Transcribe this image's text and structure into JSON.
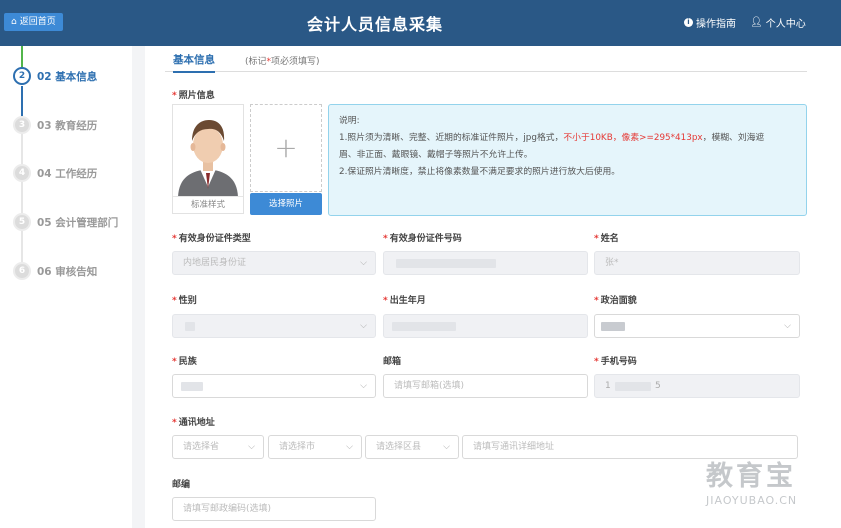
{
  "header": {
    "back_label": "返回首页",
    "title": "会计人员信息采集",
    "guide_label": "操作指南",
    "user_label": "个人中心"
  },
  "steps": [
    {
      "num": "2",
      "label": "02 基本信息",
      "active": true
    },
    {
      "num": "3",
      "label": "03 教育经历",
      "active": false
    },
    {
      "num": "4",
      "label": "04 工作经历",
      "active": false
    },
    {
      "num": "5",
      "label": "05 会计管理部门",
      "active": false
    },
    {
      "num": "6",
      "label": "06 审核告知",
      "active": false
    }
  ],
  "tabs": {
    "active_label": "基本信息",
    "note_prefix": "(标记",
    "note_star": "*",
    "note_suffix": "项必须填写)"
  },
  "photo": {
    "label": "照片信息",
    "sample_caption": "标准样式",
    "upload_plus": "+",
    "choose_button": "选择照片"
  },
  "notice": {
    "title": "说明:",
    "line1_a": "1.照片须为清晰、完整、近期的标准证件照片，jpg格式，",
    "line1_red": "不小于10KB，像素>=295*413px",
    "line1_b": "，模糊、刘海遮",
    "line2": "眉、非正面、戴眼镜、戴帽子等照片不允许上传。",
    "line3": "2.保证照片清晰度，禁止将像素数量不满足要求的照片进行放大后使用。"
  },
  "form": {
    "id_type": {
      "label": "有效身份证件类型",
      "value": "内地居民身份证"
    },
    "id_number": {
      "label": "有效身份证件号码"
    },
    "name": {
      "label": "姓名",
      "value": "张*"
    },
    "gender": {
      "label": "性别"
    },
    "birth": {
      "label": "出生年月"
    },
    "political": {
      "label": "政治面貌"
    },
    "ethnicity": {
      "label": "民族"
    },
    "email": {
      "label": "邮箱",
      "placeholder": "请填写邮箱(选填)"
    },
    "phone": {
      "label": "手机号码",
      "value_a": "1",
      "value_b": "5"
    },
    "address": {
      "label": "通讯地址",
      "province": "请选择省",
      "city": "请选择市",
      "district": "请选择区县",
      "detail": "请填写通讯详细地址"
    },
    "postcode": {
      "label": "邮编",
      "placeholder": "请填写邮政编码(选填)"
    }
  },
  "watermark": {
    "cn": "教育宝",
    "en": "JIAOYUBAO.CN"
  },
  "colors": {
    "header": "#2a5886",
    "accent": "#2d6fb0",
    "button": "#3d8ad6",
    "required": "#e53935",
    "notice_bg": "#e5f5fb"
  }
}
